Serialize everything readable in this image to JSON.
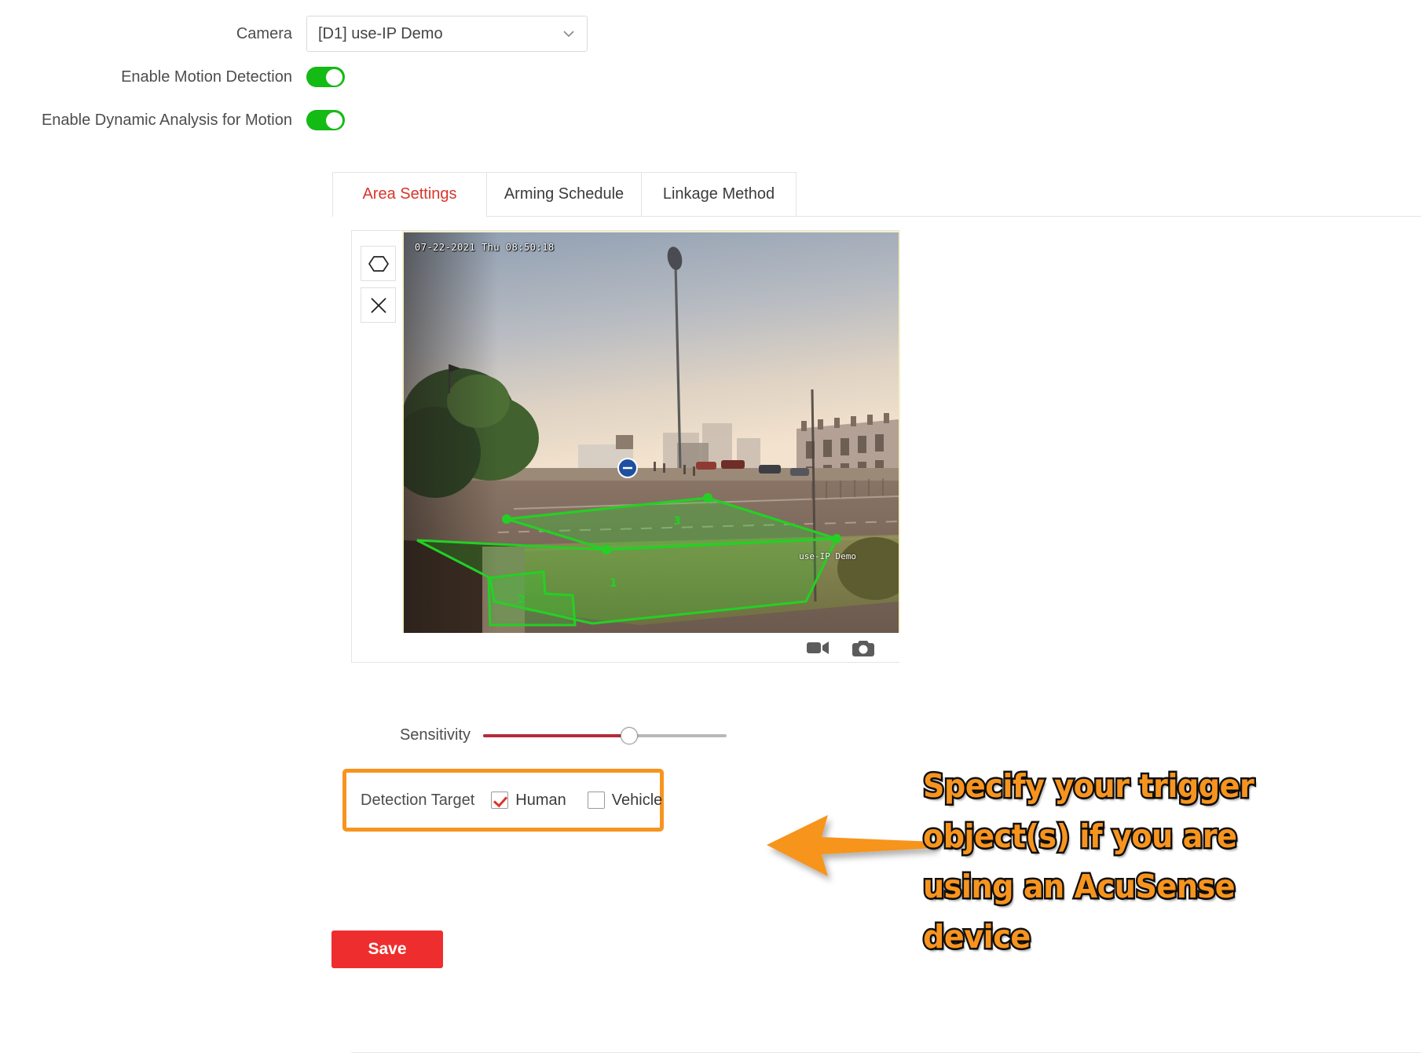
{
  "form": {
    "camera_label": "Camera",
    "camera_value": "[D1] use-IP Demo",
    "motion_label": "Enable Motion Detection",
    "motion_state": "on",
    "dynamic_label": "Enable Dynamic Analysis for Motion",
    "dynamic_state": "on"
  },
  "tabs": [
    {
      "label": "Area Settings",
      "active": true
    },
    {
      "label": "Arming Schedule",
      "active": false
    },
    {
      "label": "Linkage Method",
      "active": false
    }
  ],
  "video": {
    "timestamp": "07-22-2021 Thu 08:50:18",
    "watermark": "use-IP Demo",
    "tools": [
      {
        "name": "draw-area-icon",
        "label": "Draw Area"
      },
      {
        "name": "clear-area-icon",
        "label": "Clear"
      }
    ],
    "controls": [
      {
        "name": "record-icon",
        "label": "Record"
      },
      {
        "name": "capture-icon",
        "label": "Capture"
      }
    ],
    "areas": [
      {
        "id": "1",
        "label": "1"
      },
      {
        "id": "2",
        "label": "2"
      },
      {
        "id": "3",
        "label": "3"
      }
    ],
    "area_color": "#24d024"
  },
  "sensitivity": {
    "label": "Sensitivity",
    "value": 60,
    "fill_color": "#b52b3a",
    "track_color": "#b9b9b9"
  },
  "detection_target": {
    "label": "Detection Target",
    "options": [
      {
        "label": "Human",
        "checked": true
      },
      {
        "label": "Vehicle",
        "checked": false
      }
    ],
    "highlight_color": "#f7941e",
    "check_color": "#d9352c"
  },
  "footer": {
    "save_label": "Save",
    "save_color": "#ee2e2e"
  },
  "annotation": {
    "color": "#f7941e",
    "lines": [
      "Specify your trigger",
      "object(s) if you are",
      "using an AcuSense",
      "device"
    ]
  }
}
